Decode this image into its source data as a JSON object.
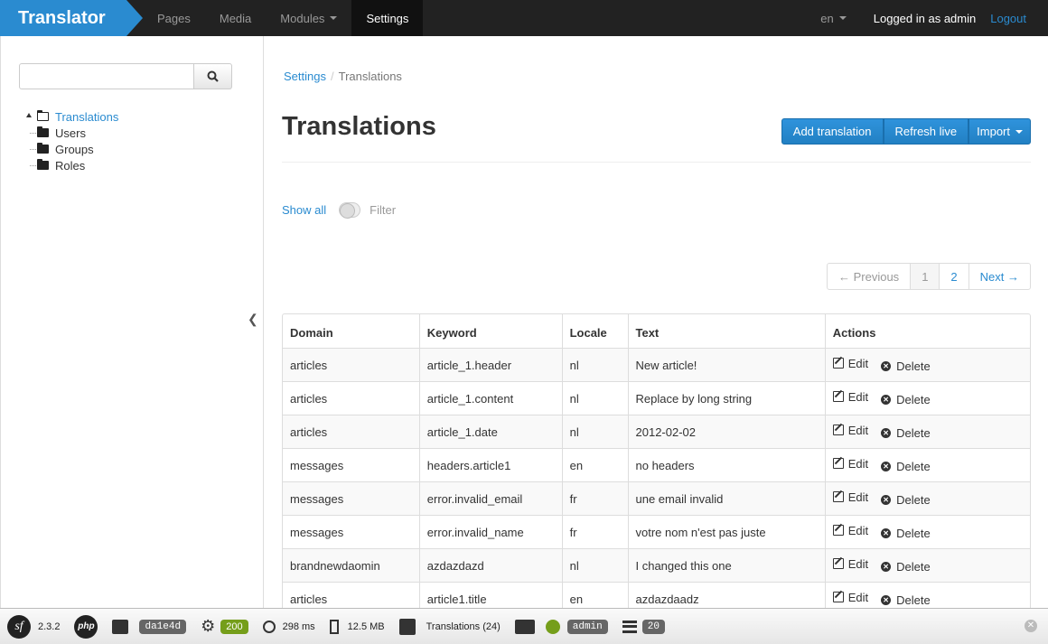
{
  "navbar": {
    "brand": "Translator",
    "items": [
      {
        "label": "Pages"
      },
      {
        "label": "Media"
      },
      {
        "label": "Modules"
      },
      {
        "label": "Settings"
      }
    ],
    "lang": "en",
    "logged_in": "Logged in as admin",
    "logout": "Logout"
  },
  "sidebar": {
    "search_placeholder": "",
    "tree": [
      {
        "label": "Translations"
      },
      {
        "label": "Users"
      },
      {
        "label": "Groups"
      },
      {
        "label": "Roles"
      }
    ]
  },
  "main": {
    "breadcrumb": {
      "root": "Settings",
      "current": "Translations"
    },
    "title": "Translations",
    "buttons": {
      "add": "Add translation",
      "refresh": "Refresh live",
      "import": "Import"
    },
    "filter": {
      "show_all": "Show all",
      "filter": "Filter"
    },
    "pagination": {
      "previous": "← Previous",
      "pages": [
        "1",
        "2"
      ],
      "next": "Next →"
    },
    "table": {
      "headers": [
        "Domain",
        "Keyword",
        "Locale",
        "Text",
        "Actions"
      ],
      "edit_label": "Edit",
      "delete_label": "Delete",
      "rows": [
        [
          "articles",
          "article_1.header",
          "nl",
          "New article!"
        ],
        [
          "articles",
          "article_1.content",
          "nl",
          "Replace by long string"
        ],
        [
          "articles",
          "article_1.date",
          "nl",
          "2012-02-02"
        ],
        [
          "messages",
          "headers.article1",
          "en",
          "no headers"
        ],
        [
          "messages",
          "error.invalid_email",
          "fr",
          "une email invalid"
        ],
        [
          "messages",
          "error.invalid_name",
          "fr",
          "votre nom n'est pas juste"
        ],
        [
          "brandnewdaomin",
          "azdazdazd",
          "nl",
          "I changed this one"
        ],
        [
          "articles",
          "article1.title",
          "en",
          "azdazdaadz"
        ]
      ]
    }
  },
  "toolbar": {
    "version": "2.3.2",
    "php": "php",
    "token": "da1e4d",
    "status": "200",
    "time": "298 ms",
    "memory": "12.5 MB",
    "translations": "Translations (24)",
    "user": "admin",
    "queries": "20"
  }
}
